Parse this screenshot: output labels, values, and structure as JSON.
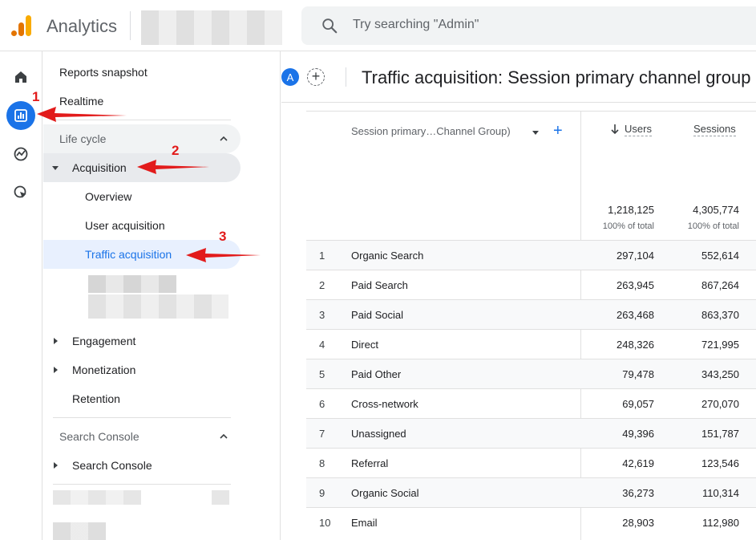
{
  "header": {
    "app_title": "Analytics",
    "search_placeholder": "Try searching \"Admin\""
  },
  "rail": {
    "items": [
      {
        "icon": "home-icon"
      },
      {
        "icon": "reports-icon",
        "active": true
      },
      {
        "icon": "explore-icon"
      },
      {
        "icon": "advertising-icon"
      }
    ]
  },
  "nav": {
    "reports_snapshot": "Reports snapshot",
    "realtime": "Realtime",
    "life_cycle": "Life cycle",
    "acquisition": "Acquisition",
    "overview": "Overview",
    "user_acquisition": "User acquisition",
    "traffic_acquisition": "Traffic acquisition",
    "engagement": "Engagement",
    "monetization": "Monetization",
    "retention": "Retention",
    "search_console_section": "Search Console",
    "search_console_item": "Search Console"
  },
  "main": {
    "avatar_letter": "A",
    "title": "Traffic acquisition: Session primary channel group"
  },
  "table": {
    "dimension_header": "Session primary…Channel Group)",
    "columns": {
      "users": "Users",
      "sessions": "Sessions"
    },
    "totals": {
      "users": "1,218,125",
      "sessions": "4,305,774",
      "users_pct": "100% of total",
      "sessions_pct": "100% of total"
    },
    "rows": [
      {
        "idx": "1",
        "channel": "Organic Search",
        "users": "297,104",
        "sessions": "552,614"
      },
      {
        "idx": "2",
        "channel": "Paid Search",
        "users": "263,945",
        "sessions": "867,264"
      },
      {
        "idx": "3",
        "channel": "Paid Social",
        "users": "263,468",
        "sessions": "863,370"
      },
      {
        "idx": "4",
        "channel": "Direct",
        "users": "248,326",
        "sessions": "721,995"
      },
      {
        "idx": "5",
        "channel": "Paid Other",
        "users": "79,478",
        "sessions": "343,250"
      },
      {
        "idx": "6",
        "channel": "Cross-network",
        "users": "69,057",
        "sessions": "270,070"
      },
      {
        "idx": "7",
        "channel": "Unassigned",
        "users": "49,396",
        "sessions": "151,787"
      },
      {
        "idx": "8",
        "channel": "Referral",
        "users": "42,619",
        "sessions": "123,546"
      },
      {
        "idx": "9",
        "channel": "Organic Social",
        "users": "36,273",
        "sessions": "110,314"
      },
      {
        "idx": "10",
        "channel": "Email",
        "users": "28,903",
        "sessions": "112,980"
      }
    ]
  },
  "annotations": {
    "one": "1",
    "two": "2",
    "three": "3"
  },
  "colors": {
    "accent": "#1a73e8",
    "annotation": "#e21b1b",
    "selected_bg": "#e8f0fe"
  }
}
